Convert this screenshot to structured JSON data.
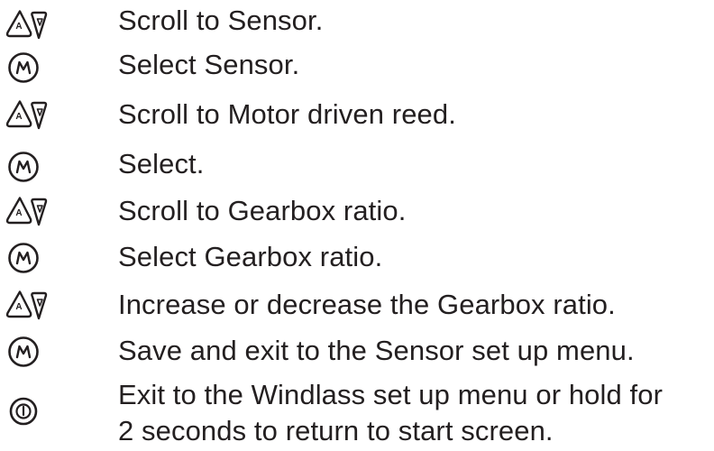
{
  "steps": [
    {
      "icon": "up-down-arrows-icon",
      "lines": [
        "Scroll to Sensor."
      ]
    },
    {
      "icon": "menu-m-button-icon",
      "lines": [
        "Select Sensor."
      ]
    },
    {
      "icon": "up-down-arrows-icon",
      "lines": [
        "Scroll to Motor driven reed."
      ]
    },
    {
      "icon": "menu-m-button-icon",
      "lines": [
        "Select."
      ]
    },
    {
      "icon": "up-down-arrows-icon",
      "lines": [
        "Scroll to Gearbox ratio."
      ]
    },
    {
      "icon": "menu-m-button-icon",
      "lines": [
        "Select Gearbox ratio."
      ]
    },
    {
      "icon": "up-down-arrows-icon",
      "lines": [
        "Increase or decrease the Gearbox ratio."
      ]
    },
    {
      "icon": "menu-m-button-icon",
      "lines": [
        "Save and exit to the Sensor set up menu."
      ]
    },
    {
      "icon": "power-button-icon",
      "lines": [
        "Exit to the Windlass set up menu or hold for",
        "2 seconds to return to start screen."
      ]
    }
  ]
}
